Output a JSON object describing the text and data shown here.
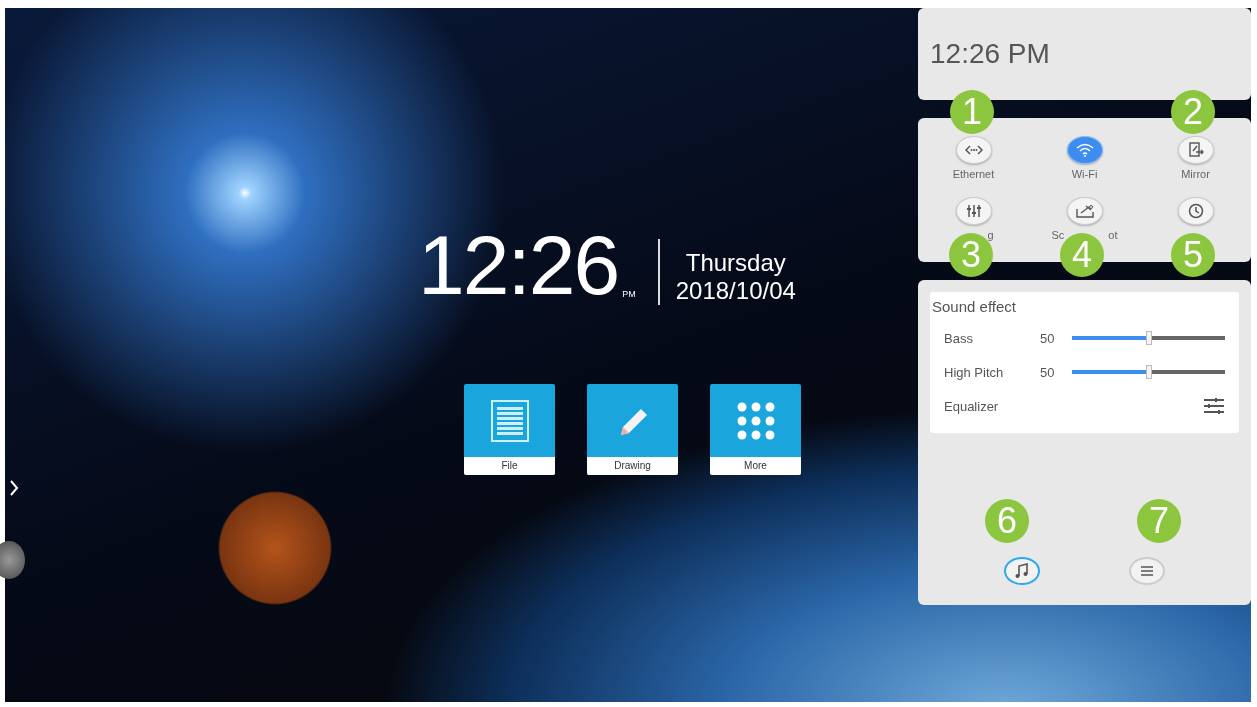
{
  "desktop": {
    "clock": {
      "time": "12:26",
      "meridiem": "PM",
      "weekday": "Thursday",
      "date": "2018/10/04"
    },
    "apps": [
      {
        "kind": "file",
        "label": "File"
      },
      {
        "kind": "drawing",
        "label": "Drawing"
      },
      {
        "kind": "more",
        "label": "More"
      }
    ]
  },
  "panel": {
    "time": "12:26 PM",
    "toggles": [
      {
        "kind": "ethernet",
        "label": "Ethernet",
        "on": false
      },
      {
        "kind": "wifi",
        "label": "Wi-Fi",
        "on": true
      },
      {
        "kind": "mirror",
        "label": "Mirror",
        "on": false
      },
      {
        "kind": "settings",
        "label_parts": [
          "g"
        ],
        "on": false
      },
      {
        "kind": "screenshot",
        "label_parts": [
          "Sc",
          "ot"
        ],
        "on": false
      },
      {
        "kind": "clock",
        "on": false
      }
    ],
    "sound": {
      "title": "Sound effect",
      "sliders": [
        {
          "name": "Bass",
          "reading": "50",
          "level": 0.5
        },
        {
          "name": "High Pitch",
          "reading": "50",
          "level": 0.5
        }
      ],
      "equalizer": "Equalizer"
    },
    "tabs": [
      {
        "kind": "music",
        "selected": true
      },
      {
        "kind": "menu",
        "selected": false
      }
    ]
  },
  "callouts": [
    "1",
    "2",
    "3",
    "4",
    "5",
    "6",
    "7"
  ]
}
